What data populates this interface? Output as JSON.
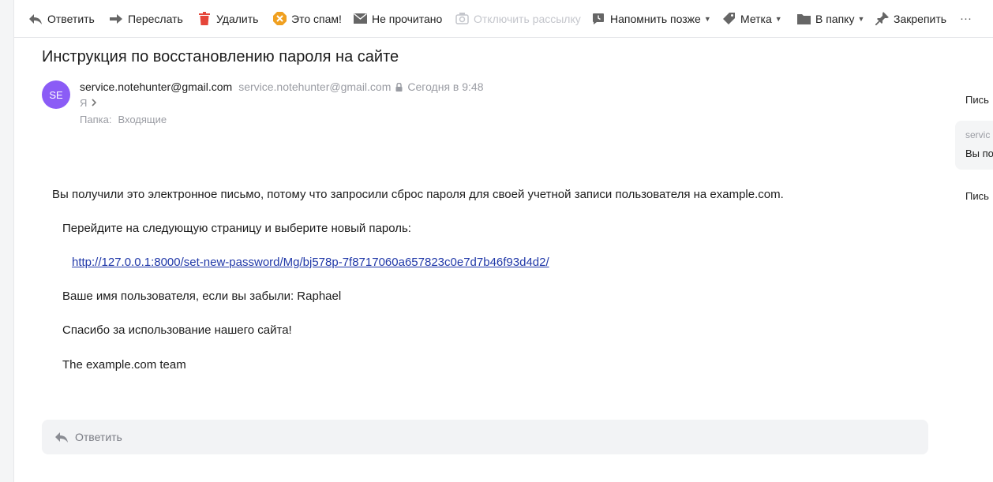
{
  "toolbar": {
    "reply": "Ответить",
    "forward": "Переслать",
    "delete": "Удалить",
    "spam": "Это спам!",
    "unread": "Не прочитано",
    "unsubscribe": "Отключить рассылку",
    "remind": "Напомнить позже",
    "label": "Метка",
    "to_folder": "В папку",
    "pin": "Закрепить",
    "more": "···"
  },
  "message": {
    "subject": "Инструкция по восстановлению пароля на сайте",
    "avatar_initials": "SE",
    "sender_name": "service.notehunter@gmail.com",
    "sender_address": "service.notehunter@gmail.com",
    "date": "Сегодня в 9:48",
    "recipient": "Я",
    "folder_label": "Папка:",
    "folder_value": "Входящие",
    "body": {
      "line1": "Вы получили это электронное письмо, потому что запросили сброс пароля для своей учетной записи пользователя на example.com.",
      "line2": "Перейдите на следующую страницу и выберите новый пароль:",
      "link": "http://127.0.0.1:8000/set-new-password/Mg/bj578p-7f8717060a657823c0e7d7b46f93d4d2/",
      "line3": "Ваше имя пользователя, если вы забыли: Raphael",
      "line4": "Спасибо за использование нашего сайта!",
      "line5": "The example.com team"
    }
  },
  "reply_bar": {
    "label": "Ответить"
  },
  "right_panel": {
    "item1": "Пись",
    "card_sender": "servic",
    "card_preview": "Вы по",
    "item2": "Пись"
  },
  "colors": {
    "avatar": "#8b5cf6",
    "link": "#2038a8",
    "delete_icon": "#e5463a",
    "spam_icon": "#f0a020"
  }
}
